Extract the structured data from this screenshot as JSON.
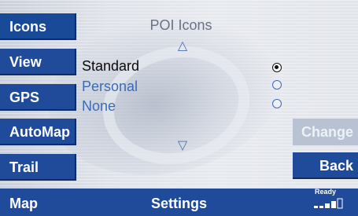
{
  "sidebar": {
    "items": [
      {
        "label": "Icons"
      },
      {
        "label": "View"
      },
      {
        "label": "GPS"
      },
      {
        "label": "AutoMap"
      },
      {
        "label": "Trail"
      }
    ]
  },
  "main": {
    "title": "POI Icons",
    "scroll_up_glyph": "△",
    "scroll_down_glyph": "▽",
    "options": [
      {
        "label": "Standard",
        "selected": true
      },
      {
        "label": "Personal",
        "selected": false
      },
      {
        "label": "None",
        "selected": false
      }
    ]
  },
  "right_buttons": {
    "change_label": "Change",
    "back_label": "Back"
  },
  "bottom_bar": {
    "left_label": "Map",
    "center_label": "Settings",
    "status_label": "Ready"
  },
  "colors": {
    "accent": "#1f4b9a",
    "option_unselected": "#3b6bb4",
    "disabled_button": "#b8c2d3"
  }
}
